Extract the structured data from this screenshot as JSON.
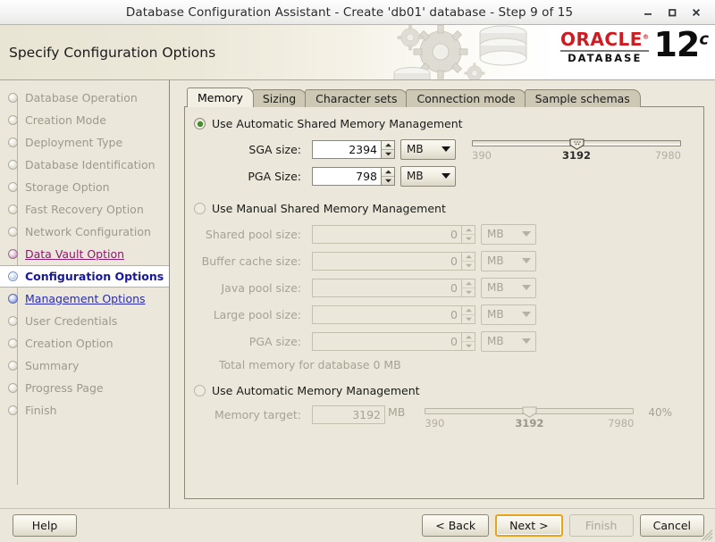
{
  "window": {
    "title": "Database Configuration Assistant - Create 'db01' database - Step 9 of 15",
    "minimize_label": "Minimize",
    "maximize_label": "Maximize",
    "close_label": "Close"
  },
  "header": {
    "title": "Specify Configuration Options",
    "brand": "ORACLE",
    "brand_reg": "®",
    "brand_sub": "DATABASE",
    "version": "12",
    "version_sup": "c",
    "brand_color": "#cf1c22"
  },
  "sidebar": {
    "items": [
      {
        "label": "Database Operation",
        "state": "done"
      },
      {
        "label": "Creation Mode",
        "state": "done"
      },
      {
        "label": "Deployment Type",
        "state": "done"
      },
      {
        "label": "Database Identification",
        "state": "done"
      },
      {
        "label": "Storage Option",
        "state": "done"
      },
      {
        "label": "Fast Recovery Option",
        "state": "done"
      },
      {
        "label": "Network Configuration",
        "state": "done"
      },
      {
        "label": "Data Vault Option",
        "state": "visited"
      },
      {
        "label": "Configuration Options",
        "state": "current"
      },
      {
        "label": "Management Options",
        "state": "link"
      },
      {
        "label": "User Credentials",
        "state": "done"
      },
      {
        "label": "Creation Option",
        "state": "done"
      },
      {
        "label": "Summary",
        "state": "done"
      },
      {
        "label": "Progress Page",
        "state": "done"
      },
      {
        "label": "Finish",
        "state": "done"
      }
    ]
  },
  "tabs": [
    {
      "label": "Memory",
      "mnemonic": "M",
      "active": true
    },
    {
      "label": "Sizing",
      "mnemonic": "S",
      "active": false
    },
    {
      "label": "Character sets",
      "mnemonic": "C",
      "active": false
    },
    {
      "label": "Connection mode",
      "mnemonic": "o",
      "active": false
    },
    {
      "label": "Sample schemas",
      "mnemonic": "e",
      "active": false
    }
  ],
  "memory_tab": {
    "automatic_shared": {
      "radio_label_pre": "Use ",
      "radio_label_mnemonic": "U",
      "radio_label_post": "se Automatic Shared Memory Management",
      "radio_label": "Use Automatic Shared Memory Management",
      "selected": true,
      "sga": {
        "label": "SGA size:",
        "value": "2394",
        "unit": "MB"
      },
      "pga": {
        "label": "PGA Size:",
        "value": "798",
        "unit": "MB"
      },
      "slider": {
        "min_label": "390",
        "current_label": "3192",
        "max_label": "7980",
        "min": 390,
        "max": 7980,
        "value": 3192
      }
    },
    "manual_shared": {
      "radio_label": "Use Manual Shared Memory Management",
      "selected": false,
      "fields": [
        {
          "label": "Shared pool size:",
          "value": "0",
          "unit": "MB"
        },
        {
          "label": "Buffer cache size:",
          "value": "0",
          "unit": "MB"
        },
        {
          "label": "Java pool size:",
          "value": "0",
          "unit": "MB"
        },
        {
          "label": "Large pool size:",
          "value": "0",
          "unit": "MB"
        },
        {
          "label": "PGA size:",
          "value": "0",
          "unit": "MB"
        }
      ],
      "total_text": "Total memory for database 0 MB"
    },
    "automatic_memory": {
      "radio_label": "Use Automatic Memory Management",
      "selected": false,
      "memory_target": {
        "label": "Memory target:",
        "value": "3192",
        "unit": "MB"
      },
      "slider": {
        "min_label": "390",
        "current_label": "3192",
        "max_label": "7980",
        "min": 390,
        "max": 7980,
        "value": 3192
      },
      "percent_label": "40%"
    }
  },
  "footer": {
    "help": "Help",
    "back": "< Back",
    "next": "Next >",
    "finish": "Finish",
    "cancel": "Cancel"
  }
}
